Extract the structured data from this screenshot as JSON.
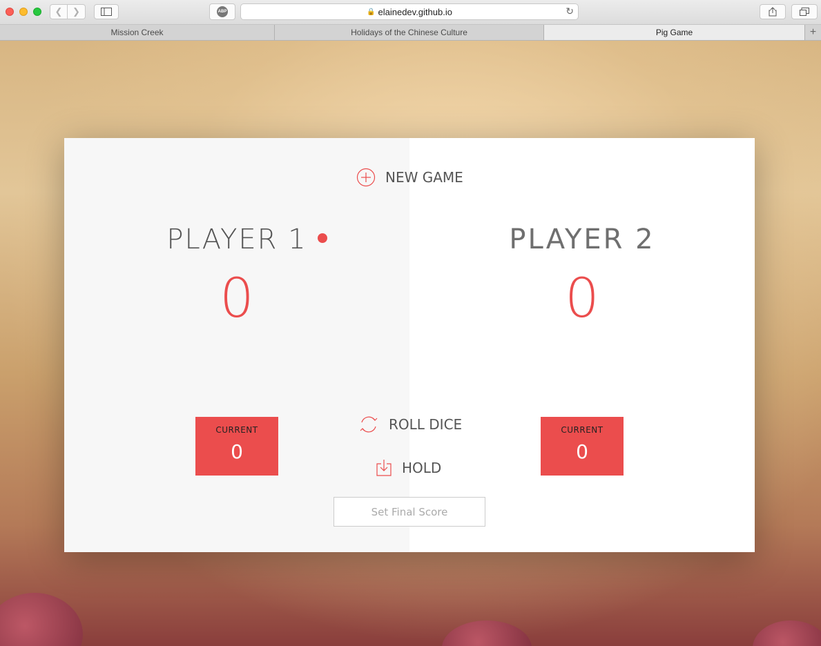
{
  "browser": {
    "url": "elainedev.github.io",
    "adblock_label": "ABP",
    "tabs": [
      {
        "label": "Mission Creek"
      },
      {
        "label": "Holidays of the Chinese Culture"
      },
      {
        "label": "Pig Game"
      }
    ],
    "new_tab_symbol": "+"
  },
  "game": {
    "new_game_label": "NEW GAME",
    "roll_dice_label": "ROLL DICE",
    "hold_label": "HOLD",
    "final_score_placeholder": "Set Final Score",
    "active_player": 1,
    "accent_color": "#eb4d4d",
    "players": [
      {
        "name": "PLAYER 1",
        "score": "0",
        "current_label": "CURRENT",
        "current": "0"
      },
      {
        "name": "PLAYER 2",
        "score": "0",
        "current_label": "CURRENT",
        "current": "0"
      }
    ]
  }
}
